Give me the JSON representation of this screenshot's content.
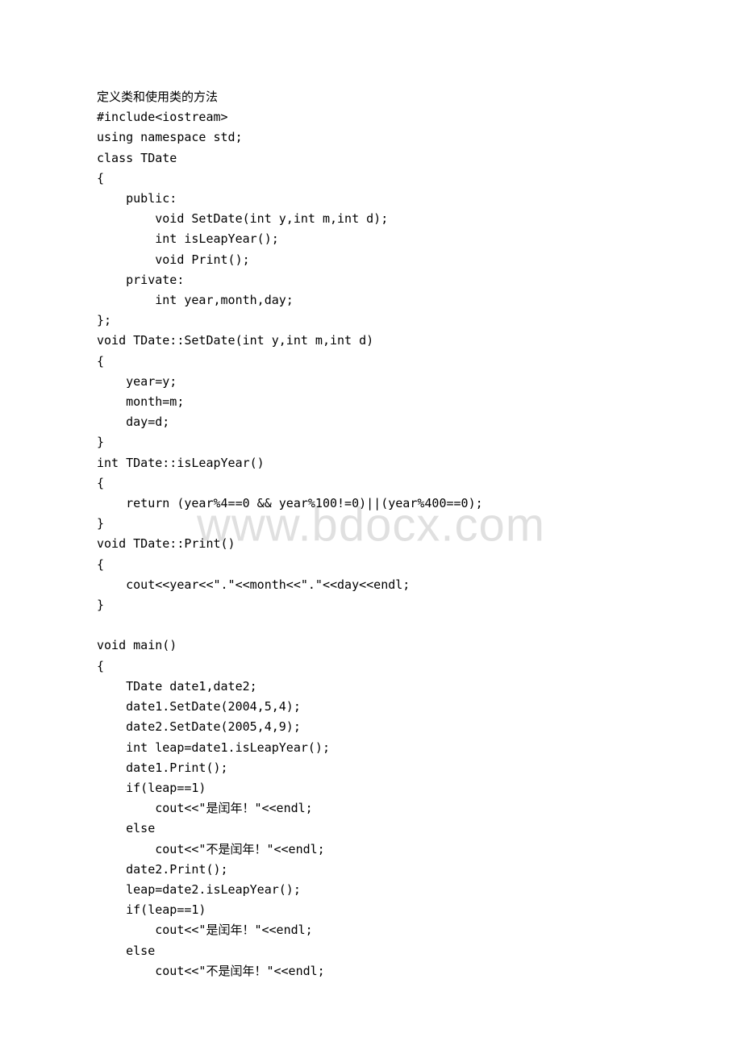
{
  "watermark": "www.bdocx.com",
  "lines": [
    "定义类和使用类的方法",
    "#include<iostream>",
    "using namespace std;",
    "class TDate",
    "{",
    "    public:",
    "        void SetDate(int y,int m,int d);",
    "        int isLeapYear();",
    "        void Print();",
    "    private:",
    "        int year,month,day;",
    "};",
    "void TDate::SetDate(int y,int m,int d)",
    "{",
    "    year=y;",
    "    month=m;",
    "    day=d;",
    "}",
    "int TDate::isLeapYear()",
    "{",
    "    return (year%4==0 && year%100!=0)||(year%400==0);",
    "}",
    "void TDate::Print()",
    "{",
    "    cout<<year<<\".\"<<month<<\".\"<<day<<endl;",
    "}",
    "",
    "void main()",
    "{",
    "    TDate date1,date2;",
    "    date1.SetDate(2004,5,4);",
    "    date2.SetDate(2005,4,9);",
    "    int leap=date1.isLeapYear();",
    "    date1.Print();",
    "    if(leap==1)",
    "        cout<<\"是闰年！\"<<endl;",
    "    else",
    "        cout<<\"不是闰年！\"<<endl;",
    "    date2.Print();",
    "    leap=date2.isLeapYear();",
    "    if(leap==1)",
    "        cout<<\"是闰年！\"<<endl;",
    "    else",
    "        cout<<\"不是闰年！\"<<endl;"
  ]
}
